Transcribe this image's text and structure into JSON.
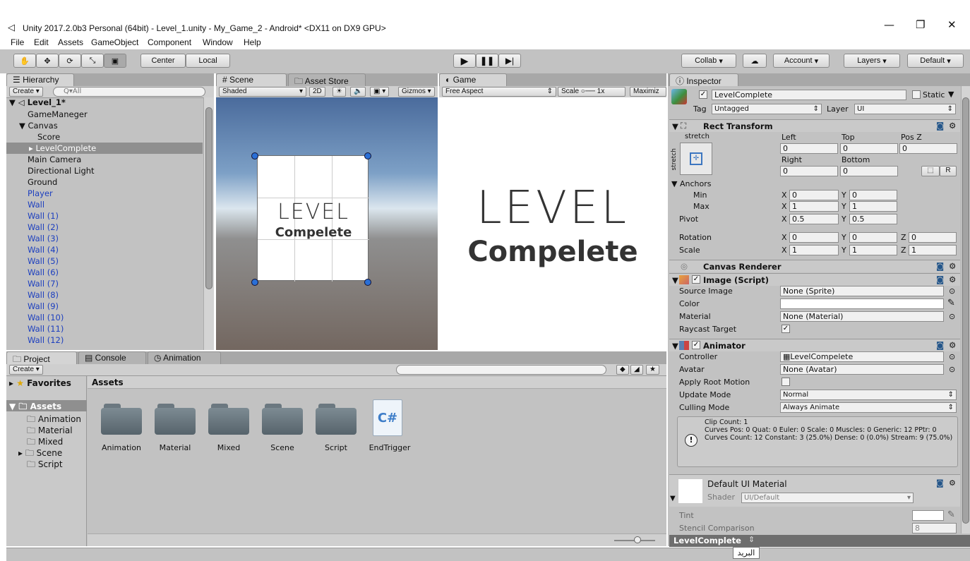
{
  "window": {
    "title": "Unity 2017.2.0b3 Personal (64bit) - Level_1.unity - My_Game_2 - Android* <DX11 on DX9 GPU>",
    "controls": [
      "—",
      "❐",
      "✕"
    ]
  },
  "menu": [
    "File",
    "Edit",
    "Assets",
    "GameObject",
    "Component",
    "Window",
    "Help"
  ],
  "toolbar": {
    "pivot_mode": "Center",
    "pivot_space": "Local",
    "collab": "Collab",
    "account": "Account",
    "layers": "Layers",
    "layout": "Default"
  },
  "hierarchy": {
    "tab": "Hierarchy",
    "create": "Create",
    "search_placeholder": "Q▾All",
    "scene": "Level_1*",
    "items": [
      {
        "label": "GameManeger",
        "indent": 1,
        "blue": false
      },
      {
        "label": "Canvas",
        "indent": 1,
        "blue": false,
        "expanded": true
      },
      {
        "label": "Score",
        "indent": 2,
        "blue": false
      },
      {
        "label": "LevelComplete",
        "indent": 2,
        "blue": false,
        "selected": true
      },
      {
        "label": "Main Camera",
        "indent": 1,
        "blue": false
      },
      {
        "label": "Directional Light",
        "indent": 1,
        "blue": false
      },
      {
        "label": "Ground",
        "indent": 1,
        "blue": false
      },
      {
        "label": "Player",
        "indent": 1,
        "blue": true
      },
      {
        "label": "Wall",
        "indent": 1,
        "blue": true
      },
      {
        "label": "Wall (1)",
        "indent": 1,
        "blue": true
      },
      {
        "label": "Wall (2)",
        "indent": 1,
        "blue": true
      },
      {
        "label": "Wall (3)",
        "indent": 1,
        "blue": true
      },
      {
        "label": "Wall (4)",
        "indent": 1,
        "blue": true
      },
      {
        "label": "Wall (5)",
        "indent": 1,
        "blue": true
      },
      {
        "label": "Wall (6)",
        "indent": 1,
        "blue": true
      },
      {
        "label": "Wall (7)",
        "indent": 1,
        "blue": true
      },
      {
        "label": "Wall (8)",
        "indent": 1,
        "blue": true
      },
      {
        "label": "Wall (9)",
        "indent": 1,
        "blue": true
      },
      {
        "label": "Wall (10)",
        "indent": 1,
        "blue": true
      },
      {
        "label": "Wall (11)",
        "indent": 1,
        "blue": true
      },
      {
        "label": "Wall (12)",
        "indent": 1,
        "blue": true
      }
    ]
  },
  "scene": {
    "tab_scene": "Scene",
    "tab_store": "Asset Store",
    "shading": "Shaded",
    "mode2d": "2D",
    "gizmos": "Gizmos",
    "text_line1": "LEVEL",
    "text_line2": "Compelete"
  },
  "game": {
    "tab": "Game",
    "aspect": "Free Aspect",
    "scale_label": "Scale",
    "scale_value": "1x",
    "maximize": "Maximiz",
    "text_line1": "LEVEL",
    "text_line2": "Compelete"
  },
  "project": {
    "tabs": [
      "Project",
      "Console",
      "Animation"
    ],
    "create": "Create",
    "favorites": "Favorites",
    "assets_root": "Assets",
    "breadcrumb": "Assets",
    "tree": [
      "Animation",
      "Material",
      "Mixed",
      "Scene",
      "Script"
    ],
    "items": [
      {
        "label": "Animation",
        "kind": "folder"
      },
      {
        "label": "Material",
        "kind": "folder"
      },
      {
        "label": "Mixed",
        "kind": "folder"
      },
      {
        "label": "Scene",
        "kind": "folder"
      },
      {
        "label": "Script",
        "kind": "folder"
      },
      {
        "label": "EndTrigger",
        "kind": "csharp"
      }
    ],
    "csharp_glyph": "C#"
  },
  "inspector": {
    "tab": "Inspector",
    "object_name": "LevelComplete",
    "static_label": "Static",
    "tag_label": "Tag",
    "tag_value": "Untagged",
    "layer_label": "Layer",
    "layer_value": "UI",
    "rect": {
      "title": "Rect Transform",
      "stretch": "stretch",
      "stretch_v": "stretch",
      "left_label": "Left",
      "left": "0",
      "top_label": "Top",
      "top": "0",
      "posz_label": "Pos Z",
      "posz": "0",
      "right_label": "Right",
      "right": "0",
      "bottom_label": "Bottom",
      "bottom": "0",
      "anchors_label": "Anchors",
      "min_label": "Min",
      "min_x": "0",
      "min_y": "0",
      "max_label": "Max",
      "max_x": "1",
      "max_y": "1",
      "pivot_label": "Pivot",
      "pivot_x": "0.5",
      "pivot_y": "0.5",
      "rotation_label": "Rotation",
      "rot_x": "0",
      "rot_y": "0",
      "rot_z": "0",
      "scale_label": "Scale",
      "scale_x": "1",
      "scale_y": "1",
      "scale_z": "1",
      "x": "X",
      "y": "Y",
      "z": "Z",
      "raw_btn": "R"
    },
    "canvas_renderer": "Canvas Renderer",
    "image": {
      "title": "Image (Script)",
      "source_label": "Source Image",
      "source": "None (Sprite)",
      "color_label": "Color",
      "material_label": "Material",
      "material": "None (Material)",
      "raycast_label": "Raycast Target"
    },
    "animator": {
      "title": "Animator",
      "controller_label": "Controller",
      "controller": "LevelCompelete",
      "avatar_label": "Avatar",
      "avatar": "None (Avatar)",
      "root_motion_label": "Apply Root Motion",
      "update_label": "Update Mode",
      "update": "Normal",
      "culling_label": "Culling Mode",
      "culling": "Always Animate",
      "info": "Clip Count: 1\nCurves Pos: 0 Quat: 0 Euler: 0 Scale: 0 Muscles: 0 Generic: 12 PPtr: 0\nCurves Count: 12 Constant: 3 (25.0%) Dense: 0 (0.0%) Stream: 9 (75.0%)"
    },
    "material": {
      "name": "Default UI Material",
      "shader_label": "Shader",
      "shader": "UI/Default",
      "tint_label": "Tint",
      "stencil_label": "Stencil Comparison",
      "stencil": "8"
    },
    "footer": "LevelComplete"
  },
  "tooltip": "البريد",
  "colors": {
    "panel": "#c2c2c2",
    "blue_text": "#1c3fbf",
    "sky_top": "#4b6a9a",
    "ground": "#75685f"
  }
}
